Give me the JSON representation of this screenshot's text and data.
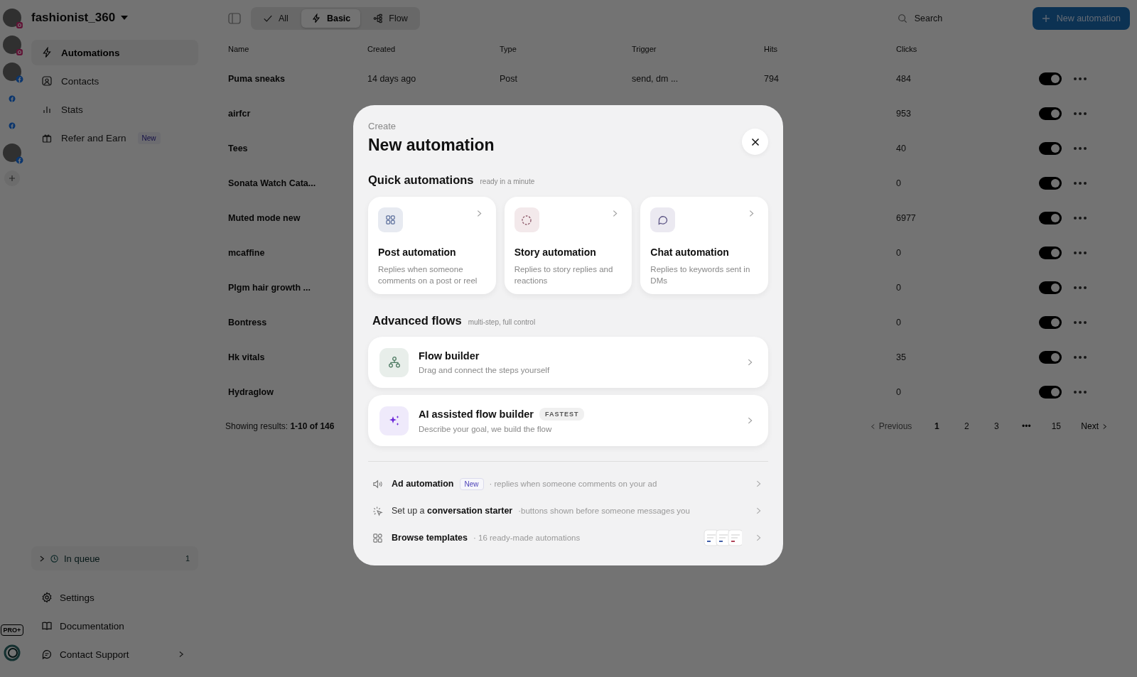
{
  "accounts": [
    {
      "kind": "instagram",
      "avatar": true
    },
    {
      "kind": "instagram",
      "avatar": true
    },
    {
      "kind": "facebook",
      "avatar": true
    },
    {
      "kind": "facebook",
      "avatar": false
    },
    {
      "kind": "facebook",
      "avatar": false
    },
    {
      "kind": "facebook",
      "avatar": true
    }
  ],
  "workspace": {
    "name": "fashionist_360"
  },
  "plan_badge": "PRO+",
  "sidebar": {
    "items": [
      {
        "kind": "bolt",
        "label": "Automations",
        "selected": true
      },
      {
        "kind": "contact",
        "label": "Contacts",
        "selected": false
      },
      {
        "kind": "stats",
        "label": "Stats",
        "selected": false
      },
      {
        "kind": "gift",
        "label": "Refer and Earn",
        "selected": false,
        "badge": "New"
      }
    ],
    "queue": {
      "label": "In queue",
      "count": "1",
      "expanded": false
    },
    "footer": [
      {
        "kind": "gear",
        "label": "Settings",
        "submenu": false
      },
      {
        "kind": "book",
        "label": "Documentation",
        "submenu": false
      },
      {
        "kind": "support",
        "label": "Contact Support",
        "submenu": true
      }
    ]
  },
  "filters": [
    {
      "kind": "check",
      "label": "All",
      "selected": false
    },
    {
      "kind": "bolt",
      "label": "Basic",
      "selected": true
    },
    {
      "kind": "flow",
      "label": "Flow",
      "selected": false
    }
  ],
  "search": {
    "placeholder": "Search"
  },
  "new_button": "New automation",
  "table": {
    "columns": [
      "Name",
      "Created",
      "Type",
      "Trigger",
      "Hits",
      "Clicks"
    ],
    "rows": [
      {
        "name": "Puma sneaks",
        "created": "14 days ago",
        "type": "Post",
        "trigger": "send, dm ...",
        "hits": "794",
        "clicks": "484",
        "on": true
      },
      {
        "name": "airfcr",
        "clicks": "953",
        "on": true
      },
      {
        "name": "Tees",
        "clicks": "40",
        "on": true
      },
      {
        "name": "Sonata Watch Cata...",
        "clicks": "0",
        "on": true
      },
      {
        "name": "Muted mode new",
        "clicks": "6977",
        "on": true
      },
      {
        "name": "mcaffine",
        "clicks": "0",
        "on": true
      },
      {
        "name": "Plgm hair growth ...",
        "clicks": "0",
        "on": true
      },
      {
        "name": "Bontress",
        "clicks": "0",
        "on": true
      },
      {
        "name": "Hk vitals",
        "clicks": "35",
        "on": true
      },
      {
        "name": "Hydraglow",
        "clicks": "0",
        "on": true
      }
    ]
  },
  "results": {
    "label": "Showing results:",
    "range": "1-10 of 146"
  },
  "pagination": {
    "previous": {
      "label": "Previous",
      "disabled": true
    },
    "pages": [
      {
        "label": "1",
        "selected": true
      },
      {
        "label": "2",
        "selected": false
      },
      {
        "label": "3",
        "selected": false
      },
      {
        "label": "•••",
        "selected": false
      },
      {
        "label": "15",
        "selected": false
      }
    ],
    "next": {
      "label": "Next",
      "disabled": false
    }
  },
  "modal": {
    "eyebrow": "Create",
    "title": "New automation",
    "quick": {
      "title": "Quick automations",
      "hint": "ready in a minute",
      "cards": [
        {
          "kind": "post",
          "title": "Post automation",
          "description": "Replies when someone comments on a post or reel"
        },
        {
          "kind": "story",
          "title": "Story automation",
          "description": "Replies to story replies and reactions"
        },
        {
          "kind": "chat",
          "title": "Chat automation",
          "description": "Replies to keywords sent in DMs"
        }
      ]
    },
    "advanced": {
      "title": "Advanced flows",
      "hint": "multi-step, full control",
      "items": [
        {
          "kind": "flow",
          "title": "Flow builder",
          "description": "Drag and connect the steps yourself"
        },
        {
          "kind": "ai",
          "title": "AI assisted flow builder",
          "badge": "FASTEST",
          "description": "Describe your goal, we build the flow"
        }
      ]
    },
    "links": [
      {
        "kind": "ad",
        "label": "Ad automation",
        "badge": "New",
        "hint": "· replies when someone comments on your ad",
        "preview": false
      },
      {
        "kind": "starter",
        "prefix": "Set up a",
        "label": "conversation starter",
        "hint": "·buttons shown before someone messages you",
        "preview": false
      },
      {
        "kind": "templates",
        "label": "Browse templates",
        "hint": "· 16 ready-made automations",
        "preview": true
      }
    ]
  }
}
